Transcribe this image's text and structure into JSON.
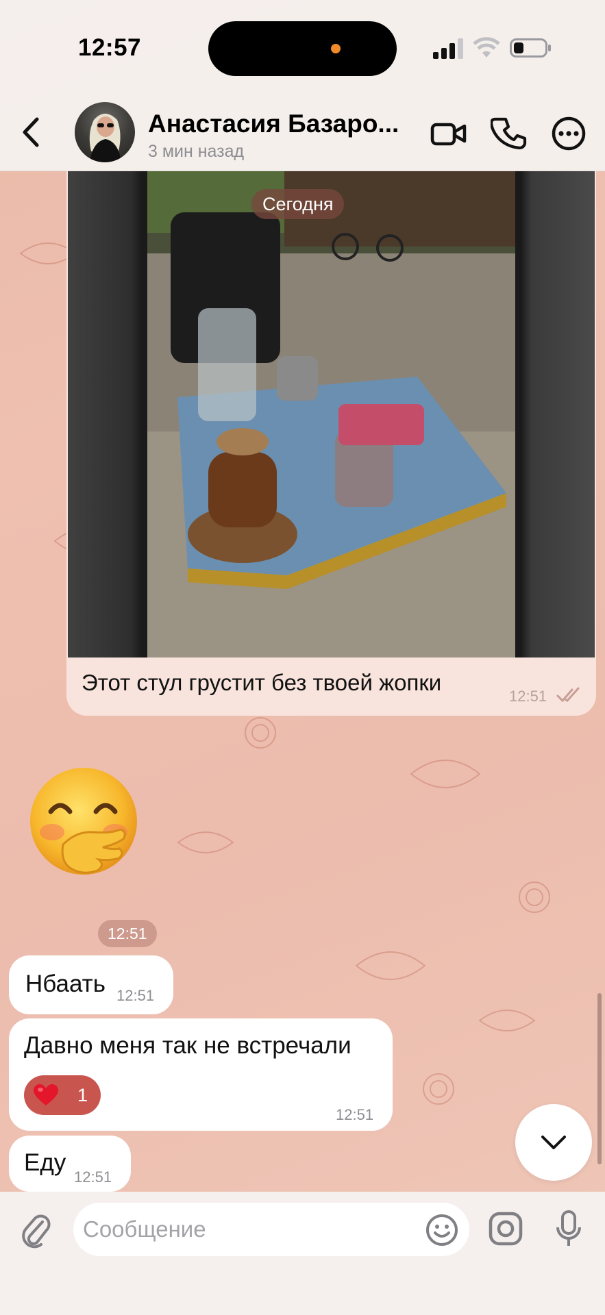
{
  "status_bar": {
    "time": "12:57"
  },
  "header": {
    "contact_name": "Анастасия Базаро...",
    "last_seen": "3 мин назад",
    "icons": [
      "back-icon",
      "video-call-icon",
      "phone-icon",
      "more-icon"
    ]
  },
  "chat": {
    "date_pill": "Сегодня",
    "photo_message": {
      "caption": "Этот стул грустит без твоей жопки",
      "time": "12:51",
      "status": "read"
    },
    "emoji_message": {
      "emoji": "face-with-hand-over-mouth",
      "time": "12:51"
    },
    "messages": [
      {
        "text": "Нбаать",
        "time": "12:51"
      },
      {
        "text": "Давно меня так не встречали",
        "time": "12:51",
        "reaction": {
          "emoji": "red-heart",
          "count": "1"
        }
      },
      {
        "text": "Еду",
        "time": "12:51"
      }
    ]
  },
  "composer": {
    "placeholder": "Сообщение",
    "value": "",
    "icons": [
      "attach-icon",
      "sticker-icon",
      "camera-icon",
      "microphone-icon"
    ]
  },
  "colors": {
    "wallpaper": "#ecbcad",
    "reaction": "#c9554f",
    "date_pill": "#78483e"
  }
}
